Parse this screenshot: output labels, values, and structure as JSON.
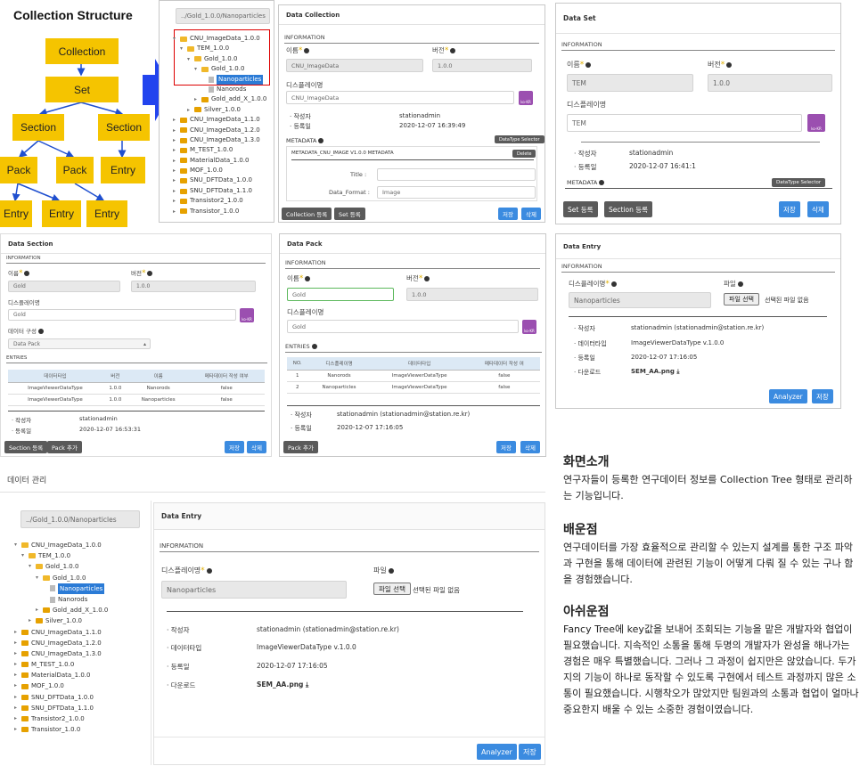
{
  "diagram": {
    "title": "Collection Structure",
    "nodes": [
      "Collection",
      "Set",
      "Section",
      "Section",
      "Pack",
      "Pack",
      "Entry",
      "Entry",
      "Entry",
      "Entry"
    ]
  },
  "tree": {
    "path": "../Gold_1.0.0/Nanoparticles",
    "items": [
      "CNU_ImageData_1.0.0",
      "TEM_1.0.0",
      "Gold_1.0.0",
      "Gold_1.0.0",
      "Nanoparticles",
      "Nanorods",
      "Gold_add_X_1.0.0",
      "Silver_1.0.0",
      "CNU_ImageData_1.1.0",
      "CNU_ImageData_1.2.0",
      "CNU_ImageData_1.3.0",
      "M_TEST_1.0.0",
      "MaterialData_1.0.0",
      "MOF_1.0.0",
      "SNU_DFTData_1.0.0",
      "SNU_DFTData_1.1.0",
      "Transistor2_1.0.0",
      "Transistor_1.0.0"
    ]
  },
  "collection": {
    "header": "Data Collection",
    "info": "INFORMATION",
    "name_label": "이름",
    "ver_label": "버전",
    "name": "CNU_ImageData",
    "ver": "1.0.0",
    "disp_label": "디스플레이명",
    "disp": "CNU_ImageData",
    "ko": "ko-KR",
    "author_label": "작성자",
    "author": "stationadmin",
    "date_label": "등록일",
    "date": "2020-12-07 16:39:49",
    "metadata": "METADATA",
    "dts": "DataType Selector",
    "meta_name": "METADATA_CNU_IMAGE V1.0.0 METADATA",
    "del": "Delete",
    "title_label": "Title :",
    "format_label": "Data_Format :",
    "format": "Image",
    "btn_reg": "Collection 등록",
    "btn_set": "Set 등록",
    "save": "저장",
    "delete": "삭제"
  },
  "set": {
    "header": "Data Set",
    "info": "INFORMATION",
    "name_label": "이름",
    "ver_label": "버전",
    "name": "TEM",
    "ver": "1.0.0",
    "disp_label": "디스플레이명",
    "disp": "TEM",
    "ko": "ko-KR",
    "author_label": "작성자",
    "author": "stationadmin",
    "date_label": "등록일",
    "date": "2020-12-07 16:41:1",
    "metadata": "METADATA",
    "dts": "DataType Selector",
    "btn_set": "Set 등록",
    "btn_sec": "Section 등록",
    "save": "저장",
    "delete": "삭제"
  },
  "section": {
    "header": "Data Section",
    "info": "INFORMATION",
    "name_label": "이름",
    "ver_label": "버전",
    "name": "Gold",
    "ver": "1.0.0",
    "disp_label": "디스플레이명",
    "disp": "Gold",
    "ko": "ko-KR",
    "comp_label": "데이터 구성",
    "comp": "Data Pack",
    "entries": "ENTRIES",
    "cols": [
      "데이터타입",
      "버전",
      "이름",
      "메타데이터 작성 여부"
    ],
    "rows": [
      [
        "ImageViewerDataType",
        "1.0.0",
        "Nanorods",
        "false"
      ],
      [
        "ImageViewerDataType",
        "1.0.0",
        "Nanoparticles",
        "false"
      ]
    ],
    "author_label": "작성자",
    "author": "stationadmin",
    "date_label": "등록일",
    "date": "2020-12-07 16:53:31",
    "btn_sec": "Section 등록",
    "btn_pack": "Pack 추가",
    "save": "저장",
    "delete": "삭제"
  },
  "pack": {
    "header": "Data Pack",
    "info": "INFORMATION",
    "name_label": "이름",
    "ver_label": "버전",
    "name": "Gold",
    "ver": "1.0.0",
    "disp_label": "디스플레이명",
    "disp": "Gold",
    "ko": "ko-KR",
    "entries": "ENTRIES",
    "cols": [
      "NO.",
      "디스플레이명",
      "데이터타입",
      "메타데이터 작성 여"
    ],
    "rows": [
      [
        "1",
        "Nanorods",
        "ImageViewerDataType",
        "false"
      ],
      [
        "2",
        "Nanoparticles",
        "ImageViewerDataType",
        "false"
      ]
    ],
    "author_label": "작성자",
    "author": "stationadmin (stationadmin@station.re.kr)",
    "date_label": "등록일",
    "date": "2020-12-07 17:16:05",
    "btn_pack": "Pack 추가",
    "save": "저장",
    "delete": "삭제"
  },
  "entry": {
    "header": "Data Entry",
    "info": "INFORMATION",
    "disp_label": "디스플레이명",
    "file_label": "파일",
    "disp": "Nanoparticles",
    "file_btn": "파일 선택",
    "file_none": "선택된 파일 없음",
    "author_label": "작성자",
    "author": "stationadmin (stationadmin@station.re.kr)",
    "dtype_label": "데이터타입",
    "dtype": "ImageViewerDataType v.1.0.0",
    "date_label": "등록일",
    "date": "2020-12-07 17:16:05",
    "dl_label": "다운로드",
    "dl": "SEM_AA.png",
    "analyzer": "Analyzer",
    "save": "저장"
  },
  "section_title": "데이터 관리",
  "desc": {
    "h1": "화면소개",
    "p1": "연구자들이 등록한 연구데이터 정보를 Collection Tree 형태로 관리하는 기능입니다.",
    "h2": "배운점",
    "p2": "연구데이터를 가장 효율적으로 관리할 수 있는지 설계를 통한 구조 파악과 구현을 통해 데이터에 관련된 기능이 어떻게 다뤄 질 수 있는 구나 함을 경험했습니다.",
    "h3": "아쉬운점",
    "p3": "Fancy Tree에 key값을 보내어 조회되는 기능을 맡은 개발자와 협업이 필요했습니다. 지속적인 소통을 통해 두명의 개발자가 완성을 해나가는 경험은 매우 특별했습니다. 그러나 그 과정이 쉽지만은 않았습니다. 두가지의 기능이 하나로 동작할 수 있도록 구현에서 테스트 과정까지 많은 소통이 필요했습니다. 시행착오가 많았지만 팀원과의 소통과 협업이 얼마나 중요한지 배울 수 있는 소중한 경험이였습니다."
  }
}
